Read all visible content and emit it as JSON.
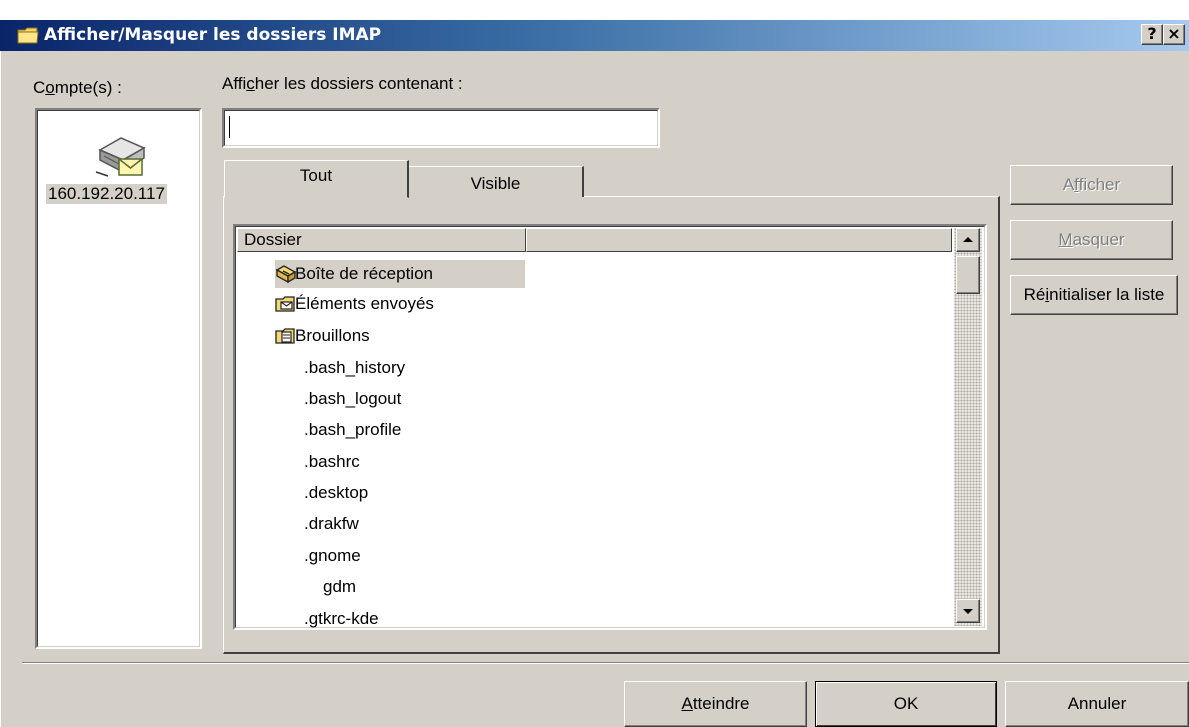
{
  "window": {
    "title": "Afficher/Masquer les dossiers IMAP",
    "help_label": "?",
    "close_label": "×"
  },
  "accounts": {
    "label_prefix": "C",
    "label_mnemonic": "o",
    "label_suffix": "mpte(s) :",
    "items": [
      {
        "label": "160.192.20.117",
        "icon": "mail-server-icon"
      }
    ]
  },
  "filter": {
    "label_prefix": "Affi",
    "label_mnemonic": "c",
    "label_suffix": "her les dossiers contenant :",
    "value": ""
  },
  "tabs": [
    {
      "label": "Tout",
      "active": true
    },
    {
      "label": "Visible",
      "active": false
    }
  ],
  "folder_list": {
    "column_header": "Dossier",
    "rows": [
      {
        "label": "Boîte de réception",
        "icon": "inbox-folder-icon",
        "indent": 0
      },
      {
        "label": "Éléments envoyés",
        "icon": "sent-folder-icon",
        "indent": 0
      },
      {
        "label": "Brouillons",
        "icon": "drafts-folder-icon",
        "indent": 0
      },
      {
        "label": ".bash_history",
        "icon": "",
        "indent": 1
      },
      {
        "label": ".bash_logout",
        "icon": "",
        "indent": 1
      },
      {
        "label": ".bash_profile",
        "icon": "",
        "indent": 1
      },
      {
        "label": ".bashrc",
        "icon": "",
        "indent": 1
      },
      {
        "label": ".desktop",
        "icon": "",
        "indent": 1
      },
      {
        "label": ".drakfw",
        "icon": "",
        "indent": 1
      },
      {
        "label": ".gnome",
        "icon": "",
        "indent": 1
      },
      {
        "label": "gdm",
        "icon": "",
        "indent": 2
      },
      {
        "label": ".gtkrc-kde",
        "icon": "",
        "indent": 1
      }
    ]
  },
  "side_buttons": {
    "show": {
      "prefix": "A",
      "mnemonic": "f",
      "suffix": "ficher",
      "enabled": false
    },
    "hide": {
      "prefix": "",
      "mnemonic": "M",
      "suffix": "asquer",
      "enabled": false
    },
    "reset": {
      "prefix": "Ré",
      "mnemonic": "i",
      "suffix": "nitialiser la liste",
      "enabled": true
    }
  },
  "footer_buttons": {
    "goto": {
      "prefix": "",
      "mnemonic": "A",
      "suffix": "tteindre"
    },
    "ok": "OK",
    "cancel": "Annuler"
  },
  "colors": {
    "face": "#d4d0c8",
    "title_start": "#0a246a",
    "title_end": "#a6caf0"
  }
}
